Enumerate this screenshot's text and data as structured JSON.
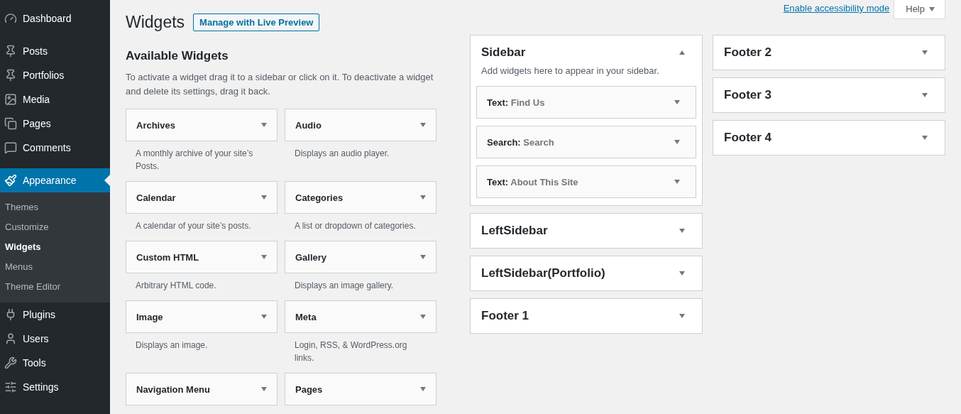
{
  "admin_menu": [
    {
      "label": "Dashboard",
      "selected": false
    },
    {
      "label": "Posts",
      "selected": false
    },
    {
      "label": "Portfolios",
      "selected": false
    },
    {
      "label": "Media",
      "selected": false
    },
    {
      "label": "Pages",
      "selected": false
    },
    {
      "label": "Comments",
      "selected": false
    },
    {
      "label": "Appearance",
      "selected": true,
      "children": [
        {
          "label": "Themes",
          "selected": false
        },
        {
          "label": "Customize",
          "selected": false
        },
        {
          "label": "Widgets",
          "selected": true
        },
        {
          "label": "Menus",
          "selected": false
        },
        {
          "label": "Theme Editor",
          "selected": false
        }
      ]
    },
    {
      "label": "Plugins",
      "selected": false
    },
    {
      "label": "Users",
      "selected": false
    },
    {
      "label": "Tools",
      "selected": false
    },
    {
      "label": "Settings",
      "selected": false
    }
  ],
  "header": {
    "title": "Widgets",
    "live_preview_button": "Manage with Live Preview",
    "accessibility_link": "Enable accessibility mode",
    "help_button": "Help"
  },
  "available_widgets": {
    "title": "Available Widgets",
    "description": "To activate a widget drag it to a sidebar or click on it. To deactivate a widget and delete its settings, drag it back.",
    "widgets": [
      {
        "name": "Archives",
        "description": "A monthly archive of your site’s Posts."
      },
      {
        "name": "Audio",
        "description": "Displays an audio player."
      },
      {
        "name": "Calendar",
        "description": "A calendar of your site’s posts."
      },
      {
        "name": "Categories",
        "description": "A list or dropdown of categories."
      },
      {
        "name": "Custom HTML",
        "description": "Arbitrary HTML code."
      },
      {
        "name": "Gallery",
        "description": "Displays an image gallery."
      },
      {
        "name": "Image",
        "description": "Displays an image."
      },
      {
        "name": "Meta",
        "description": "Login, RSS, & WordPress.org links."
      },
      {
        "name": "Navigation Menu"
      },
      {
        "name": "Pages"
      }
    ]
  },
  "widget_areas": [
    [
      {
        "title": "Sidebar",
        "expanded": true,
        "description": "Add widgets here to appear in your sidebar.",
        "widgets": [
          {
            "type": "Text:",
            "title": "Find Us"
          },
          {
            "type": "Search:",
            "title": "Search"
          },
          {
            "type": "Text:",
            "title": "About This Site"
          }
        ]
      },
      {
        "title": "LeftSidebar",
        "expanded": false
      },
      {
        "title": "LeftSidebar(Portfolio)",
        "expanded": false
      },
      {
        "title": "Footer 1",
        "expanded": false
      }
    ],
    [
      {
        "title": "Footer 2",
        "expanded": false
      },
      {
        "title": "Footer 3",
        "expanded": false
      },
      {
        "title": "Footer 4",
        "expanded": false
      }
    ]
  ]
}
